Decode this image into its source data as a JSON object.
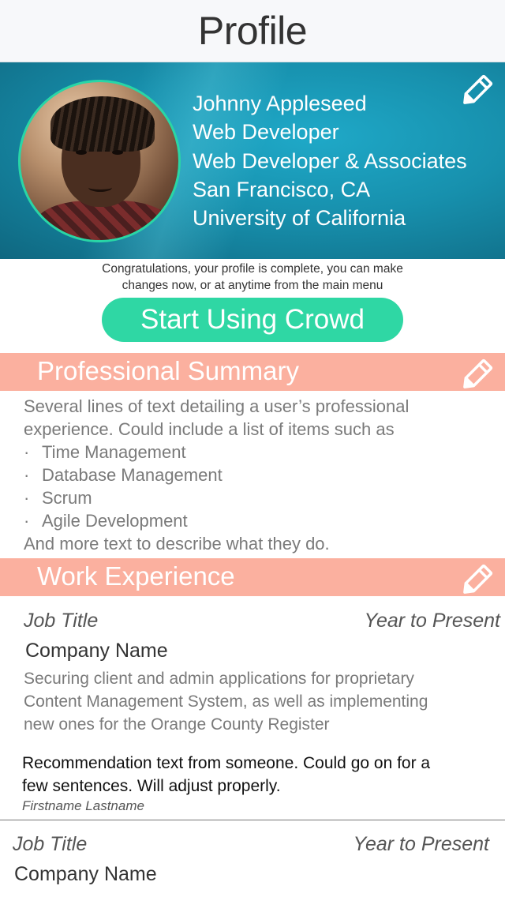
{
  "header": {
    "title": "Profile"
  },
  "profile": {
    "name": "Johnny Appleseed",
    "role": "Web Developer",
    "company": "Web Developer & Associates",
    "location": "San Francisco, CA",
    "school": "University of California"
  },
  "congrats": {
    "line1": "Congratulations, your profile is complete, you can make",
    "line2": "changes now, or at anytime from the main menu",
    "button_label": "Start Using Crowd"
  },
  "summary": {
    "header": "Professional Summary",
    "intro_line1": "Several lines of text detailing a user’s professional",
    "intro_line2": "experience.  Could include a list of items such as",
    "bullets": [
      "Time Management",
      "Database Management",
      "Scrum",
      "Agile Development"
    ],
    "outro": "And more text to describe what they do."
  },
  "work": {
    "header": "Work Experience",
    "jobs": [
      {
        "title": "Job Title",
        "period": "Year to Present",
        "company": "Company Name",
        "desc_line1": "Securing client and admin applications for proprietary",
        "desc_line2": "Content Management System, as well as implementing",
        "desc_line3": "new ones for the Orange County Register",
        "rec_line1": "Recommendation text from someone.  Could go on for a",
        "rec_line2": "few sentences.  Will adjust properly.",
        "rec_author": "Firstname Lastname"
      },
      {
        "title": "Job Title",
        "period": "Year to Present",
        "company": "Company Name"
      }
    ]
  },
  "icons": {
    "edit": "pencil-icon"
  },
  "colors": {
    "accent_green": "#2fd7a4",
    "section_salmon": "#fbb09f",
    "hero_teal": "#1790ad"
  }
}
